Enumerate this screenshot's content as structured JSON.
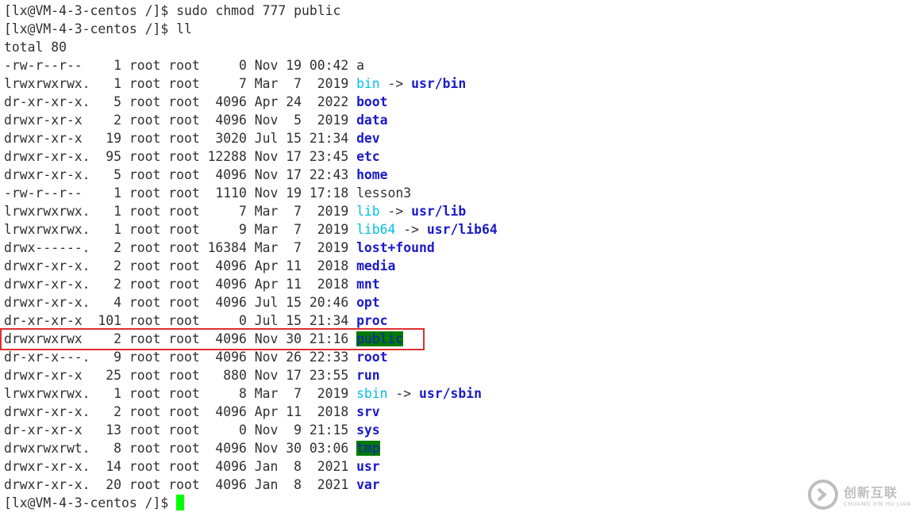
{
  "terminal": {
    "lines": [
      {
        "type": "cmd",
        "prompt": "[lx@VM-4-3-centos /]$ ",
        "command": "sudo chmod 777 public"
      },
      {
        "type": "cmd",
        "prompt": "[lx@VM-4-3-centos /]$ ",
        "command": "ll"
      },
      {
        "type": "text",
        "text": "total 80"
      },
      {
        "type": "entry",
        "meta": "-rw-r--r--    1 root root     0 Nov 19 00:42 ",
        "name": "a",
        "kind": "plain",
        "target": ""
      },
      {
        "type": "entry",
        "meta": "lrwxrwxrwx.   1 root root     7 Mar  7  2019 ",
        "name": "bin",
        "kind": "link",
        "target": "usr/bin"
      },
      {
        "type": "entry",
        "meta": "dr-xr-xr-x.   5 root root  4096 Apr 24  2022 ",
        "name": "boot",
        "kind": "dir",
        "target": ""
      },
      {
        "type": "entry",
        "meta": "drwxr-xr-x    2 root root  4096 Nov  5  2019 ",
        "name": "data",
        "kind": "dir",
        "target": ""
      },
      {
        "type": "entry",
        "meta": "drwxr-xr-x   19 root root  3020 Jul 15 21:34 ",
        "name": "dev",
        "kind": "dir",
        "target": ""
      },
      {
        "type": "entry",
        "meta": "drwxr-xr-x.  95 root root 12288 Nov 17 23:45 ",
        "name": "etc",
        "kind": "dir",
        "target": ""
      },
      {
        "type": "entry",
        "meta": "drwxr-xr-x.   5 root root  4096 Nov 17 22:43 ",
        "name": "home",
        "kind": "dir",
        "target": ""
      },
      {
        "type": "entry",
        "meta": "-rw-r--r--    1 root root  1110 Nov 19 17:18 ",
        "name": "lesson3",
        "kind": "plain",
        "target": ""
      },
      {
        "type": "entry",
        "meta": "lrwxrwxrwx.   1 root root     7 Mar  7  2019 ",
        "name": "lib",
        "kind": "link",
        "target": "usr/lib"
      },
      {
        "type": "entry",
        "meta": "lrwxrwxrwx.   1 root root     9 Mar  7  2019 ",
        "name": "lib64",
        "kind": "link",
        "target": "usr/lib64"
      },
      {
        "type": "entry",
        "meta": "drwx------.   2 root root 16384 Mar  7  2019 ",
        "name": "lost+found",
        "kind": "dir",
        "target": ""
      },
      {
        "type": "entry",
        "meta": "drwxr-xr-x.   2 root root  4096 Apr 11  2018 ",
        "name": "media",
        "kind": "dir",
        "target": ""
      },
      {
        "type": "entry",
        "meta": "drwxr-xr-x.   2 root root  4096 Apr 11  2018 ",
        "name": "mnt",
        "kind": "dir",
        "target": ""
      },
      {
        "type": "entry",
        "meta": "drwxr-xr-x.   4 root root  4096 Jul 15 20:46 ",
        "name": "opt",
        "kind": "dir",
        "target": ""
      },
      {
        "type": "entry",
        "meta": "dr-xr-xr-x  101 root root     0 Jul 15 21:34 ",
        "name": "proc",
        "kind": "dir",
        "target": ""
      },
      {
        "type": "entry",
        "meta": "drwxrwxrwx    2 root root  4096 Nov 30 21:16 ",
        "name": "public",
        "kind": "sticky",
        "target": ""
      },
      {
        "type": "entry",
        "meta": "dr-xr-x---.   9 root root  4096 Nov 26 22:33 ",
        "name": "root",
        "kind": "dir",
        "target": ""
      },
      {
        "type": "entry",
        "meta": "drwxr-xr-x   25 root root   880 Nov 17 23:55 ",
        "name": "run",
        "kind": "dir",
        "target": ""
      },
      {
        "type": "entry",
        "meta": "lrwxrwxrwx.   1 root root     8 Mar  7  2019 ",
        "name": "sbin",
        "kind": "link",
        "target": "usr/sbin"
      },
      {
        "type": "entry",
        "meta": "drwxr-xr-x.   2 root root  4096 Apr 11  2018 ",
        "name": "srv",
        "kind": "dir",
        "target": ""
      },
      {
        "type": "entry",
        "meta": "dr-xr-xr-x   13 root root     0 Nov  9 21:15 ",
        "name": "sys",
        "kind": "dir",
        "target": ""
      },
      {
        "type": "entry",
        "meta": "drwxrwxrwt.   8 root root  4096 Nov 30 03:06 ",
        "name": "tmp",
        "kind": "sticky",
        "target": ""
      },
      {
        "type": "entry",
        "meta": "drwxr-xr-x.  14 root root  4096 Jan  8  2021 ",
        "name": "usr",
        "kind": "dir",
        "target": ""
      },
      {
        "type": "entry",
        "meta": "drwxr-xr-x.  20 root root  4096 Jan  8  2021 ",
        "name": "var",
        "kind": "dir",
        "target": ""
      },
      {
        "type": "prompt",
        "prompt": "[lx@VM-4-3-centos /]$ "
      }
    ],
    "link_arrow": " -> ",
    "highlighted_entry": "public"
  },
  "colors": {
    "text": "#303030",
    "directory": "#1a1ac8",
    "symlink": "#00bfe8",
    "sticky_bg": "#007a00",
    "cursor": "#00ff00",
    "highlight_border": "#e03030"
  },
  "watermark": {
    "main": "创新互联",
    "sub": "CHUANG XIN HU LIAN",
    "icon": "logo-icon"
  }
}
